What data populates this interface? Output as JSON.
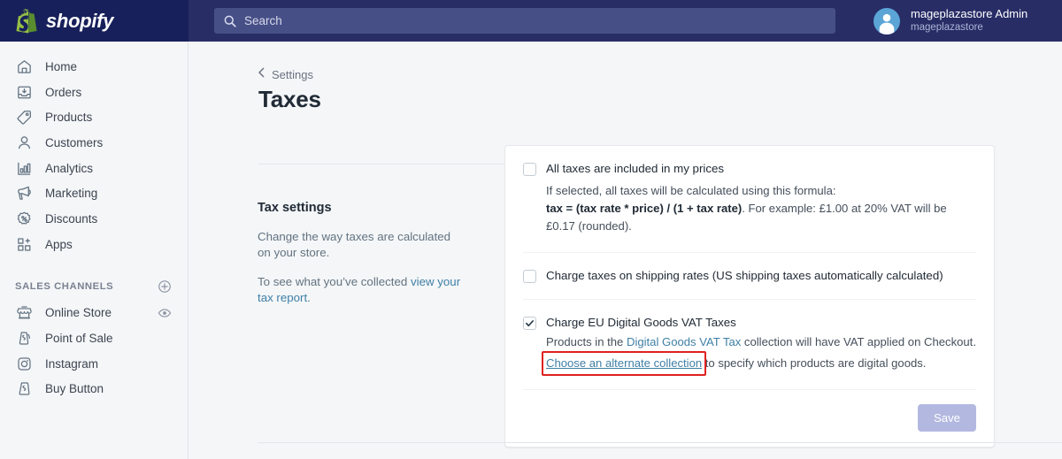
{
  "topbar": {
    "brand_name": "shopify",
    "brand_icon": "shopify-bag-icon",
    "search": {
      "icon": "search-icon",
      "placeholder": "Search",
      "value": ""
    },
    "account": {
      "avatar_icon": "user-avatar-icon",
      "name": "mageplazastore Admin",
      "store": "mageplazastore"
    }
  },
  "sidebar": {
    "items": [
      {
        "label": "Home",
        "icon": "home-icon"
      },
      {
        "label": "Orders",
        "icon": "orders-inbox-icon"
      },
      {
        "label": "Products",
        "icon": "product-tag-icon"
      },
      {
        "label": "Customers",
        "icon": "customer-person-icon"
      },
      {
        "label": "Analytics",
        "icon": "analytics-bar-chart-icon"
      },
      {
        "label": "Marketing",
        "icon": "marketing-megaphone-icon"
      },
      {
        "label": "Discounts",
        "icon": "discount-percent-icon"
      },
      {
        "label": "Apps",
        "icon": "apps-grid-plus-icon"
      }
    ],
    "sales_channels": {
      "heading": "SALES CHANNELS",
      "add_icon": "plus-circle-icon",
      "items": [
        {
          "label": "Online Store",
          "icon": "online-store-icon",
          "trailing_icon": "eye-icon"
        },
        {
          "label": "Point of Sale",
          "icon": "point-of-sale-icon",
          "trailing_icon": ""
        },
        {
          "label": "Instagram",
          "icon": "instagram-icon",
          "trailing_icon": ""
        },
        {
          "label": "Buy Button",
          "icon": "buy-button-icon",
          "trailing_icon": ""
        }
      ]
    }
  },
  "main": {
    "breadcrumb": {
      "icon": "chevron-left-icon",
      "label": "Settings"
    },
    "page_title": "Taxes",
    "description": {
      "heading": "Tax settings",
      "paragraph1": "Change the way taxes are calculated on your store.",
      "paragraph2_prefix": "To see what you’ve collected ",
      "paragraph2_link": "view your tax report",
      "paragraph2_suffix": "."
    },
    "settings": {
      "included_in_prices": {
        "label": "All taxes are included in my prices",
        "checked": false,
        "note_line1": "If selected, all taxes will be calculated using this formula:",
        "note_formula": "tax = (tax rate * price) / (1 + tax rate)",
        "note_example": ". For example: £1.00 at 20% VAT will be £0.17 (rounded)."
      },
      "shipping_rates": {
        "label": "Charge taxes on shipping rates (US shipping taxes automatically calculated)",
        "checked": false
      },
      "eu_digital_goods": {
        "label": "Charge EU Digital Goods VAT Taxes",
        "checked": true,
        "desc_prefix": "Products in the ",
        "desc_link": "Digital Goods VAT Tax",
        "desc_suffix": " collection will have VAT applied on Checkout.",
        "alt_link": "Choose an alternate collection",
        "alt_suffix": " to specify which products are digital goods.",
        "highlight_color": "#e02020"
      }
    },
    "save_button": {
      "label": "Save",
      "enabled": false
    }
  },
  "colors": {
    "header_bg": "#1c2260",
    "header_bg_right": "#282d66",
    "search_field": "#474f87",
    "page_bg": "#f4f6f8",
    "link": "#3f7fa5",
    "accent_disabled": "#b3b8e0"
  }
}
